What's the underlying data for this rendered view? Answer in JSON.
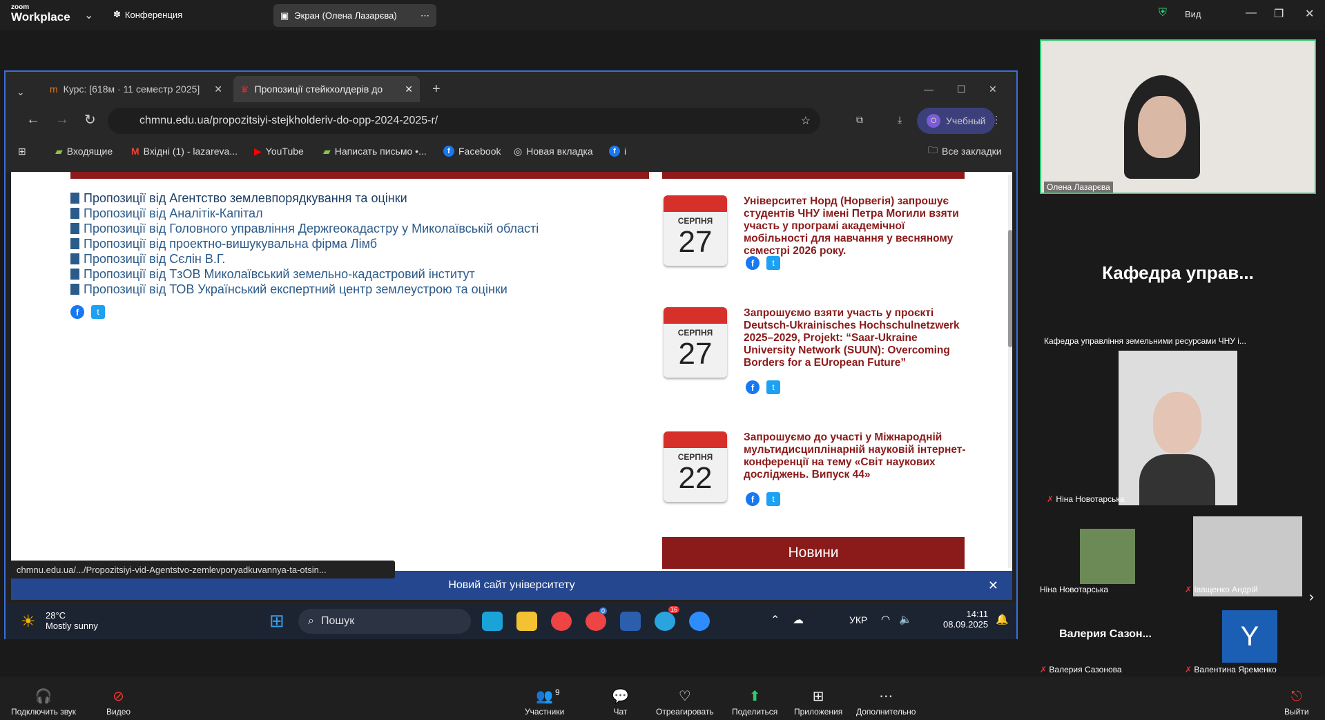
{
  "zoom": {
    "logo_small": "zoom",
    "logo_big": "Workplace",
    "conference": "Конференция",
    "share_tab": "Экран (Олена Лазарєва)",
    "view": "Вид"
  },
  "browser": {
    "tabs": [
      {
        "label": "Курс: [618м · 11 семестр 2025]"
      },
      {
        "label": "Пропозиції стейкхолдерів до"
      }
    ],
    "url": "chmnu.edu.ua/propozitsiyi-stejkholderiv-do-opp-2024-2025-r/",
    "profile": "Учебный",
    "profile_initial": "O",
    "bookmarks": [
      "Входящие",
      "Вхідні (1) - lazareva...",
      "YouTube",
      "Написать письмо •...",
      "Facebook",
      "Новая вкладка",
      "i"
    ],
    "all_bookmarks": "Все закладки",
    "status": "chmnu.edu.ua/.../Propozitsiyi-vid-Agentstvo-zemlevporyadkuvannya-ta-otsin..."
  },
  "page": {
    "links": [
      "Пропозиції від Агентство землевпорядкування та оцінки",
      "Пропозиції від Аналітік-Капітал",
      "Пропозиції від Головного управління Держгеокадастру у Миколаївській області",
      "Пропозиції від проектно-вишукувальна фірма Лімб",
      "Пропозиції від Сєлін В.Г.",
      "Пропозиції від ТзОВ Миколаївський земельно-кадастровий інститут",
      "Пропозиції від ТОВ Український експертний центр землеустрою та оцінки"
    ],
    "events": [
      {
        "month": "СЕРПНЯ",
        "day": "27",
        "title": "Університет Норд (Норвегія) запрошує студентів ЧНУ імені Петра Могили взяти участь у програмі академічної мобільності для навчання у весняному семестрі 2026 року."
      },
      {
        "month": "СЕРПНЯ",
        "day": "27",
        "title": "Запрошуємо взяти участь у проєкті Deutsch-Ukrainisches Hochschulnetzwerk 2025–2029, Projekt: “Saar-Ukraine University Network (SUUN): Overcoming Borders for a EUropean Future”"
      },
      {
        "month": "СЕРПНЯ",
        "day": "22",
        "title": "Запрошуємо до участі у Міжнародній мультидисциплінарній науковій інтернет-конференції на тему «Світ наукових досліджень. Випуск 44»"
      }
    ],
    "news": "Новини",
    "banner": "Новий сайт університету"
  },
  "taskbar": {
    "temp": "28°C",
    "weather": "Mostly sunny",
    "search": "Пошук",
    "lang": "УКР",
    "time": "14:11",
    "date": "08.09.2025",
    "tg_badge": "16",
    "chrome_badge": "0"
  },
  "participants": {
    "speaker": "Олена Лазарєва",
    "dept_big": "Кафедра управ...",
    "dept_full": "Кафедра управління земельними ресурсами ЧНУ і...",
    "p1": "Ніна Новотарська",
    "p2": "Ніна Новотарська",
    "p3": "Іващенко Андрій",
    "p4_big": "Валерия Сазон...",
    "p4": "Валерия Сазонова",
    "p5": "Валентина Яременко",
    "p5_initial": "Y"
  },
  "controls": {
    "audio": "Подключить звук",
    "video": "Видео",
    "participants": "Участники",
    "participants_count": "9",
    "chat": "Чат",
    "react": "Отреагировать",
    "share": "Поделиться",
    "apps": "Приложения",
    "more": "Дополнительно",
    "leave": "Выйти"
  }
}
